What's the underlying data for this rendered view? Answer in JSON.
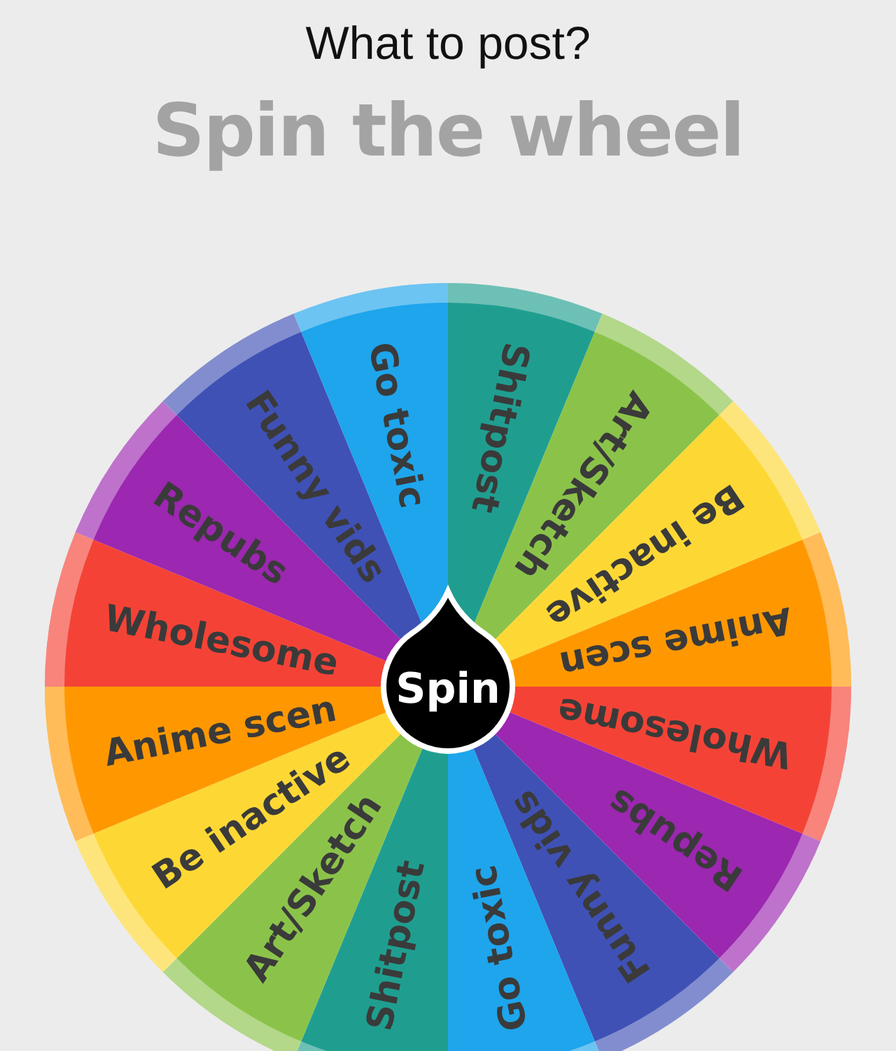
{
  "title": "What to post?",
  "heading": "Spin the wheel",
  "segments": [
    {
      "label": "Shitpost",
      "color": "#1f9e90"
    },
    {
      "label": "Art/Sketch",
      "color": "#8bc34a"
    },
    {
      "label": "Be inactive",
      "color": "#fdd835"
    },
    {
      "label": "Anime scen",
      "color": "#ff9800"
    },
    {
      "label": "Wholesome",
      "color": "#f44336"
    },
    {
      "label": "Repubs",
      "color": "#9c27b0"
    },
    {
      "label": "Funny vids",
      "color": "#3f51b5"
    },
    {
      "label": "Go toxic",
      "color": "#1ea5ec"
    },
    {
      "label": "Shitpost",
      "color": "#1f9e90"
    },
    {
      "label": "Art/Sketch",
      "color": "#8bc34a"
    },
    {
      "label": "Be inactive",
      "color": "#fdd835"
    },
    {
      "label": "Anime scen",
      "color": "#ff9800"
    },
    {
      "label": "Wholesome",
      "color": "#f44336"
    },
    {
      "label": "Repubs",
      "color": "#9c27b0"
    },
    {
      "label": "Funny vids",
      "color": "#3f51b5"
    },
    {
      "label": "Go toxic",
      "color": "#1ea5ec"
    }
  ],
  "spin_button": "Spin"
}
